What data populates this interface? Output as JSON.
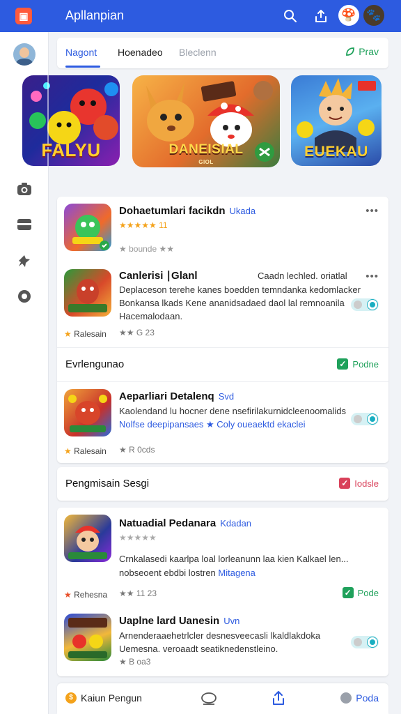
{
  "app": {
    "title": "Apllanpian",
    "logo_glyph": "▣"
  },
  "topbar": {
    "icons": [
      "search-icon",
      "share-icon"
    ],
    "avatars": [
      "🍄",
      "🐾"
    ]
  },
  "rail": {
    "icons": [
      "camera-icon",
      "card-icon",
      "pin-icon",
      "location-icon"
    ]
  },
  "tabs": {
    "items": [
      "Nagont",
      "Hoenadeo",
      "Bleclenn"
    ],
    "active": 0,
    "action_label": "Prav"
  },
  "featured": [
    {
      "title": "FALYU"
    },
    {
      "title": "DANEISIAL",
      "subtitle": "GIOL"
    },
    {
      "title": "EUEKAU"
    }
  ],
  "list1": {
    "rows": [
      {
        "title": "Dohaetumlari facikdn",
        "tag": "Ukada",
        "rating_text": "★★★★★ 11",
        "sub": "★ bounde ★★",
        "desc": "",
        "meta": ""
      },
      {
        "title": "Canlerisi ∣Glanl",
        "tag": "Caadn lechled. oriatlal",
        "desc": "Deplaceson terehe kanes boedden temndanka kedomlacker Bonkansa lkads Kene ananidsadaed daol lal remnoanila Hacemalodaan.",
        "meta": "Ralesain",
        "meta2": "★★ G 23"
      }
    ]
  },
  "section1": {
    "label": "Evrlengunao",
    "action": "Podne",
    "color": "#1fa15b"
  },
  "list2": {
    "rows": [
      {
        "title": "Aeparliari Detalenq",
        "tag": "Svd",
        "desc": "Kaolendand lu hocner dene nsefirilakurnidcleenoomalids",
        "desc_link": "Nolfse deepipansaes ★ Coly oueaektd ekaclei",
        "meta": "Ralesain",
        "meta2": "★ R 0cds"
      }
    ]
  },
  "section2": {
    "label": "Pengmisain Sesgi",
    "action": "Iodsle",
    "color": "#d9415a"
  },
  "list3": {
    "rows": [
      {
        "title": "Natuadial Pedanara",
        "tag": "Kdadan",
        "sub": "★★★★★",
        "desc": "Crnkalasedi kaarlpa loal lorleanunn laa kien Kalkael len...",
        "desc_tail": "nobseoent ebdbi lostren",
        "desc_link": "Mitagena",
        "meta": "Rehesna",
        "meta2": "★★ 11 23",
        "action": "Pode"
      },
      {
        "title": "Uaplne lard Uanesin",
        "tag": "Uvn",
        "desc": "Arnenderaaehetrlcler desnesveecasli lkaldlakdoka Uemesna. veroaadt seatiknedenstleino.",
        "meta2": "★ B oa3",
        "meta": ""
      }
    ]
  },
  "bottom": {
    "label": "Kaiun Pengun",
    "action": "Poda"
  }
}
